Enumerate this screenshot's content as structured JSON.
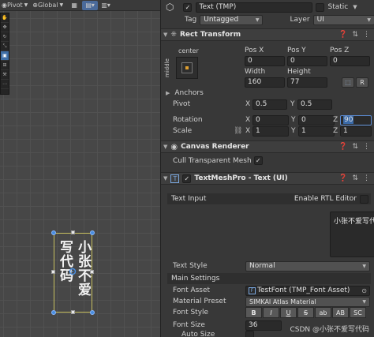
{
  "scene": {
    "toolbar": {
      "pivot": "Pivot",
      "global": "Global"
    },
    "text_col_right": "小张不爱",
    "text_col_left": "写代码"
  },
  "inspector": {
    "object_name": "Text (TMP)",
    "static_label": "Static",
    "tag_label": "Tag",
    "tag_value": "Untagged",
    "layer_label": "Layer",
    "layer_value": "UI",
    "rect_transform": {
      "title": "Rect Transform",
      "anchor_preset_top": "center",
      "anchor_preset_side": "middle",
      "pos_x_label": "Pos X",
      "pos_y_label": "Pos Y",
      "pos_z_label": "Pos Z",
      "pos_x": "0",
      "pos_y": "0",
      "pos_z": "0",
      "width_label": "Width",
      "height_label": "Height",
      "width": "160",
      "height": "77",
      "anchors_label": "Anchors",
      "pivot_label": "Pivot",
      "pivot_x": "0.5",
      "pivot_y": "0.5",
      "rotation_label": "Rotation",
      "rot_x": "0",
      "rot_y": "0",
      "rot_z": "90",
      "scale_label": "Scale",
      "scale_x": "1",
      "scale_y": "1",
      "scale_z": "1",
      "axis_x": "X",
      "axis_y": "Y",
      "axis_z": "Z",
      "r_button": "R"
    },
    "canvas_renderer": {
      "title": "Canvas Renderer",
      "cull_label": "Cull Transparent Mesh"
    },
    "textmeshpro": {
      "title": "TextMeshPro - Text (UI)",
      "text_input_label": "Text Input",
      "rtl_label": "Enable RTL Editor",
      "text_value": "小张不爱写代码",
      "text_style_label": "Text Style",
      "text_style_value": "Normal",
      "main_settings_label": "Main Settings",
      "font_asset_label": "Font Asset",
      "font_asset_value": "TestFont (TMP_Font Asset)",
      "material_preset_label": "Material Preset",
      "material_preset_value": "SIMKAI Atlas Material",
      "font_style_label": "Font Style",
      "font_style_buttons": [
        "B",
        "I",
        "U",
        "S",
        "ab",
        "AB",
        "SC"
      ],
      "font_size_label": "Font Size",
      "font_size_value": "36",
      "auto_size_label": "Auto Size"
    }
  },
  "watermark": "CSDN @小张不爱写代码",
  "colors": {
    "accent": "#4a6a9a",
    "selection_outline": "#c8c060",
    "handle": "#4a8ee0"
  }
}
